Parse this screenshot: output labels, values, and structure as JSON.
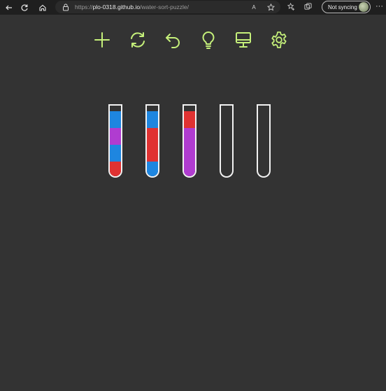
{
  "browser": {
    "url_prefix": "https://",
    "url_host": "plo-0318.github.io",
    "url_path": "/water-sort-puzzle/",
    "read_aloud_label": "A",
    "profile_label": "Not syncing"
  },
  "toolbar": {
    "accent_color": "#c5f07a",
    "items": [
      "new-game",
      "restart",
      "undo",
      "hint",
      "display",
      "settings"
    ]
  },
  "colors": {
    "background": "#333333",
    "blue": "#1e86e0",
    "purple": "#b03cd0",
    "red": "#e03232",
    "tube_outline": "#f2f2f2"
  },
  "tubes": [
    {
      "segments": [
        "blue",
        "purple",
        "blue",
        "red"
      ]
    },
    {
      "segments": [
        "blue",
        "red",
        "red",
        "blue"
      ]
    },
    {
      "segments": [
        "red",
        "purple",
        "purple",
        "purple"
      ]
    },
    {
      "segments": []
    },
    {
      "segments": []
    }
  ]
}
